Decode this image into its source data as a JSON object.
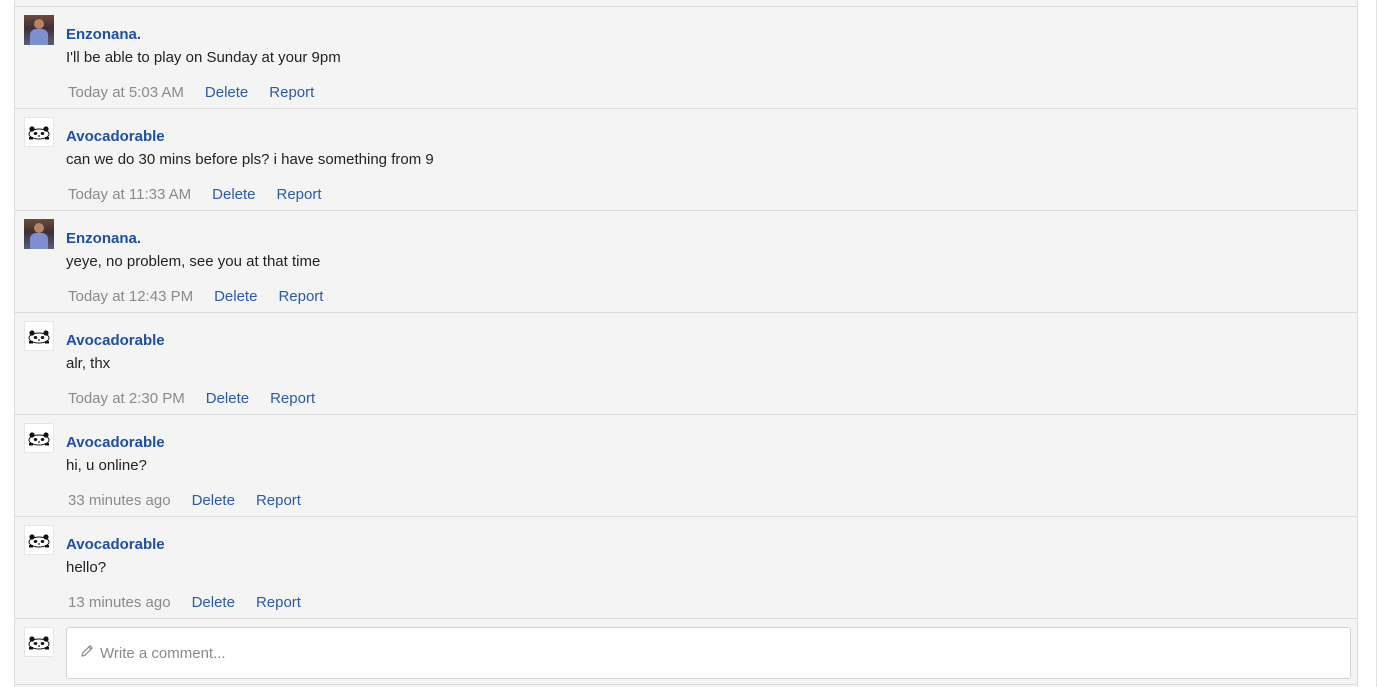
{
  "comments": [
    {
      "author": "Enzonana.",
      "avatar": "photo-avatar",
      "text": "I'll be able to play on Sunday at your 9pm",
      "time": "Today at 5:03 AM",
      "delete_label": "Delete",
      "report_label": "Report"
    },
    {
      "author": "Avocadorable",
      "avatar": "panda-avatar",
      "text": "can we do 30 mins before pls? i have something from 9",
      "time": "Today at 11:33 AM",
      "delete_label": "Delete",
      "report_label": "Report"
    },
    {
      "author": "Enzonana.",
      "avatar": "photo-avatar",
      "text": "yeye, no problem, see you at that time",
      "time": "Today at 12:43 PM",
      "delete_label": "Delete",
      "report_label": "Report"
    },
    {
      "author": "Avocadorable",
      "avatar": "panda-avatar",
      "text": "alr, thx",
      "time": "Today at 2:30 PM",
      "delete_label": "Delete",
      "report_label": "Report"
    },
    {
      "author": "Avocadorable",
      "avatar": "panda-avatar",
      "text": "hi, u online?",
      "time": "33 minutes ago",
      "delete_label": "Delete",
      "report_label": "Report"
    },
    {
      "author": "Avocadorable",
      "avatar": "panda-avatar",
      "text": "hello?",
      "time": "13 minutes ago",
      "delete_label": "Delete",
      "report_label": "Report"
    }
  ],
  "compose": {
    "placeholder": "Write a comment...",
    "icon": "pencil-icon",
    "avatar": "panda-avatar"
  },
  "colors": {
    "author": "#1f4fa3",
    "action": "#2b5aa8",
    "timestamp": "#8a8a8a",
    "background": "#f4f4f4",
    "border": "#dcdcdc"
  }
}
